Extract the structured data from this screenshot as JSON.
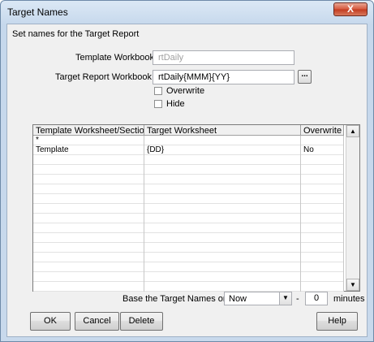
{
  "window": {
    "title": "Target Names",
    "close_glyph": "X"
  },
  "header": {
    "description": "Set names for the Target Report"
  },
  "form": {
    "template_workbook_label": "Template Workbook",
    "template_workbook_value": "rtDaily",
    "target_workbook_label": "Target Report Workbook",
    "target_workbook_value": "rtDaily{MMM}{YY}",
    "browse_label": "...",
    "overwrite_label": "Overwrite",
    "overwrite_checked": false,
    "hide_label": "Hide",
    "hide_checked": false
  },
  "grid": {
    "columns": [
      "Template Worksheet/Section",
      "Target Worksheet",
      "Overwrite"
    ],
    "rows": [
      [
        "*",
        "",
        ""
      ],
      [
        "Template",
        "{DD}",
        "No"
      ]
    ],
    "scroll_up_glyph": "▲",
    "scroll_down_glyph": "▼"
  },
  "base": {
    "label": "Base the Target Names on",
    "combo_value": "Now",
    "combo_arrow": "▼",
    "dash": "-",
    "offset_value": "0",
    "unit_label": "minutes"
  },
  "buttons": {
    "ok": "OK",
    "cancel": "Cancel",
    "delete": "Delete",
    "help": "Help"
  },
  "colors": {
    "title_bar": "#c6d8ec",
    "close_button": "#c23a1f",
    "client_background": "#f0f0f0"
  }
}
